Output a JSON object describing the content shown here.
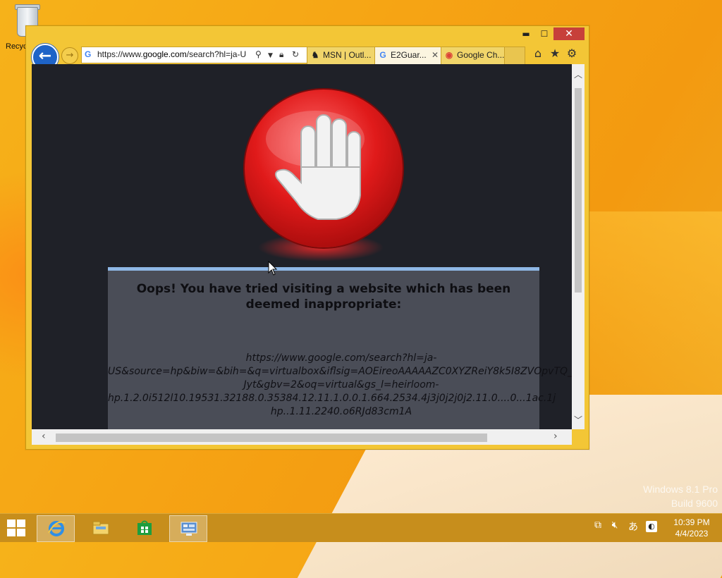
{
  "desktop": {
    "recycle_bin_label": "Recyc",
    "watermark_line1": "Windows 8.1 Pro",
    "watermark_line2": "Build 9600"
  },
  "browser": {
    "window_controls": {
      "minimize": "▬",
      "maximize": "☐",
      "close": "✕"
    },
    "address_bar": {
      "url_prefix": "https://www.",
      "url_domain": "google.com",
      "url_suffix": "/search?hl=ja-U"
    },
    "tabs": [
      {
        "label": "MSN | Outl...",
        "icon": "msn-icon",
        "active": false
      },
      {
        "label": "E2Guar...",
        "icon": "google-icon",
        "active": true
      },
      {
        "label": "Google Ch...",
        "icon": "chrome-icon",
        "active": false
      }
    ],
    "toolbar_icons": [
      "home-icon",
      "star-icon",
      "gear-icon"
    ]
  },
  "page": {
    "block_title": "Oops! You have tried visiting a website which has been deemed inappropriate:",
    "blocked_url_lines": [
      "https://www.google.com/search?hl=ja-",
      "US&source=hp&biw=&bih=&q=virtualbox&iflsig=AOEireoAAAAAZC0XYZReiY8k5I8ZVOpvTQ_L",
      "Jyt&gbv=2&oq=virtual&gs_l=heirloom-",
      "hp.1.2.0i512l10.19531.32188.0.35384.12.11.1.0.0.1.664.2534.4j3j0j2j0j2.11.0....0...1ac.1j",
      "hp..1.11.2240.o6RJd83cm1A"
    ]
  },
  "taskbar": {
    "apps": [
      "internet-explorer-icon",
      "file-explorer-icon",
      "store-icon",
      "control-panel-icon"
    ],
    "tray": {
      "ime": "あ"
    },
    "clock_time": "10:39 PM",
    "clock_date": "4/4/2023"
  },
  "colors": {
    "desktop_bg": "#f6a414",
    "window_frame": "#f3c636",
    "close_button": "#c7403a",
    "page_bg": "#1f2128",
    "panel_bg": "#4a4d57",
    "panel_accent": "#8fb8e6",
    "stop_red": "#e01a1a"
  }
}
